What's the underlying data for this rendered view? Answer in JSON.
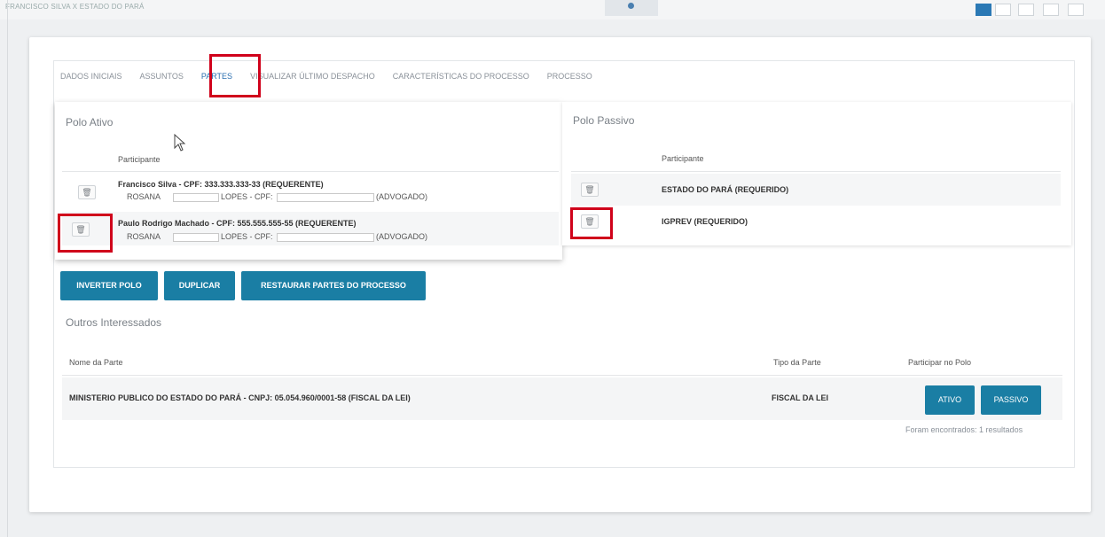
{
  "window": {
    "title": "FRANCISCO SILVA X ESTADO DO PARÁ"
  },
  "tabs": [
    {
      "label": "DADOS INICIAIS"
    },
    {
      "label": "ASSUNTOS"
    },
    {
      "label": "PARTES"
    },
    {
      "label": "VISUALIZAR ÚLTIMO DESPACHO"
    },
    {
      "label": "CARACTERÍSTICAS DO PROCESSO"
    },
    {
      "label": "PROCESSO"
    }
  ],
  "active_tab": "PARTES",
  "polo_ativo": {
    "title": "Polo Ativo",
    "column": "Participante",
    "rows": [
      {
        "name": "Francisco Silva - CPF: 333.333.333-33 (REQUERENTE)",
        "rep_prefix": "ROSANA",
        "rep_mid": "LOPES - CPF:",
        "rep_suffix": "(ADVOGADO)"
      },
      {
        "name": "Paulo Rodrigo Machado - CPF: 555.555.555-55 (REQUERENTE)",
        "rep_prefix": "ROSANA",
        "rep_mid": "LOPES - CPF:",
        "rep_suffix": "(ADVOGADO)"
      }
    ]
  },
  "polo_passivo": {
    "title": "Polo Passivo",
    "column": "Participante",
    "rows": [
      {
        "name": "ESTADO DO PARÁ (REQUERIDO)"
      },
      {
        "name": "IGPREV (REQUERIDO)"
      }
    ]
  },
  "actions": {
    "inverter": "INVERTER POLO",
    "duplicar": "DUPLICAR",
    "restaurar": "RESTAURAR PARTES DO PROCESSO"
  },
  "outros": {
    "title": "Outros Interessados",
    "headers": {
      "nome": "Nome da Parte",
      "tipo": "Tipo da Parte",
      "participar": "Participar no Polo"
    },
    "row": {
      "nome": "MINISTERIO PUBLICO DO ESTADO DO PARÁ - CNPJ: 05.054.960/0001-58 (FISCAL DA LEI)",
      "tipo": "FISCAL DA LEI"
    },
    "ativo_label": "ATIVO",
    "passivo_label": "PASSIVO",
    "result_text": "Foram encontrados: 1 resultados"
  },
  "icons": {
    "trash": "trash-icon",
    "cursor": "mouse-pointer-icon"
  },
  "colors": {
    "accent": "#1a7ea4",
    "highlight": "#d0021b",
    "active_tab": "#2a6fb0"
  }
}
